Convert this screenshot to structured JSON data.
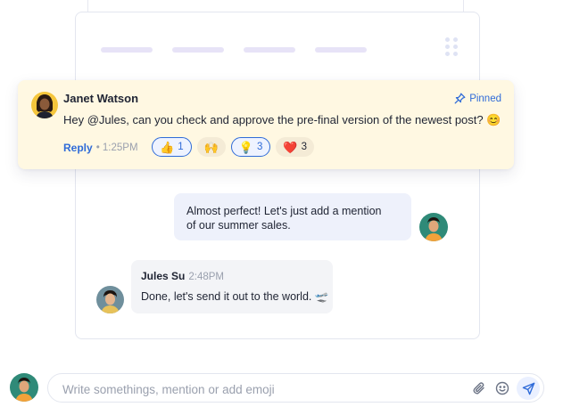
{
  "pinned_message": {
    "author": "Janet Watson",
    "pinned_label": "Pinned",
    "text": "Hey @Jules, can you check and approve the pre-final version of the newest post? 😊",
    "reply_label": "Reply",
    "time": "• 1:25PM",
    "reactions": [
      {
        "emoji": "👍",
        "count": "1",
        "active": true
      },
      {
        "emoji": "🙌",
        "count": "",
        "active": false
      },
      {
        "emoji": "💡",
        "count": "3",
        "active": true
      },
      {
        "emoji": "❤️",
        "count": "3",
        "active": false
      }
    ]
  },
  "messages": [
    {
      "side": "right",
      "text_line1": "Almost perfect! Let's just add a mention",
      "text_line2": "of our summer sales."
    },
    {
      "side": "left",
      "author": "Jules Su",
      "time": "2:48PM",
      "text": "Done, let's send it out to the world. 🛫"
    }
  ],
  "composer": {
    "placeholder": "Write somethings, mention or add emoji",
    "icons": [
      "paperclip-icon",
      "smiley-icon",
      "send-icon"
    ]
  },
  "colors": {
    "accent": "#2f6bd8",
    "pinned_bg": "#fff8e2",
    "bubble_right": "#eef1fb",
    "bubble_left": "#f3f4f7",
    "skeleton": "#e7e3f7"
  }
}
